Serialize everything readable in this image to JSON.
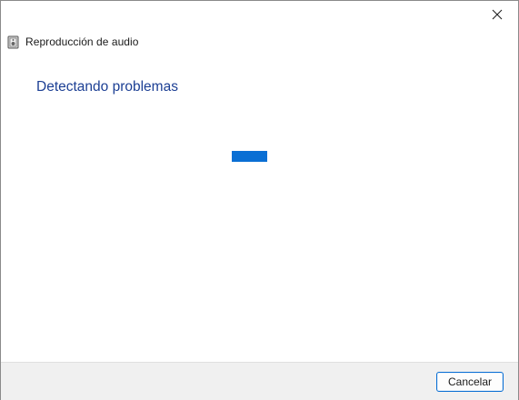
{
  "window": {
    "title": "Reproducción de audio",
    "app_icon": "speaker-icon",
    "close_icon": "close-icon"
  },
  "main": {
    "heading": "Detectando problemas",
    "progress_state": "indeterminate"
  },
  "footer": {
    "cancel_label": "Cancelar"
  },
  "colors": {
    "heading": "#1c3f94",
    "progress": "#0a6fd4",
    "footer_bg": "#f0f0f0"
  }
}
